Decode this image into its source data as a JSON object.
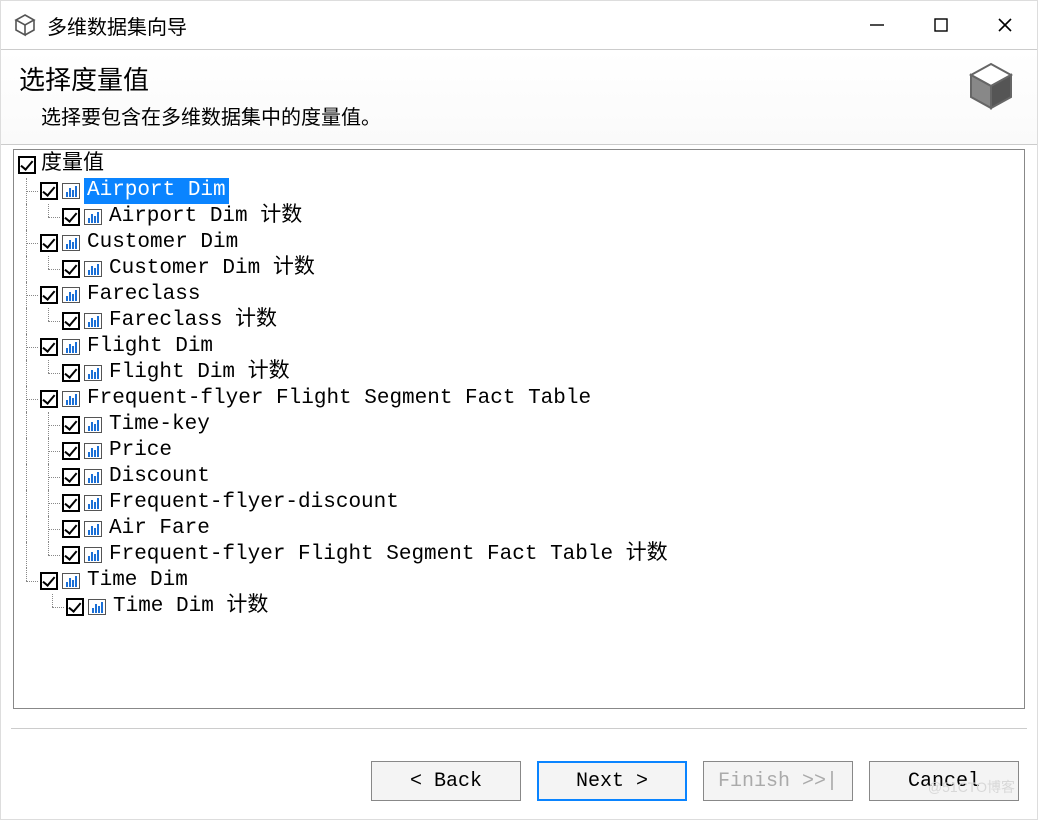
{
  "window": {
    "title": "多维数据集向导"
  },
  "header": {
    "title": "选择度量值",
    "subtitle": "选择要包含在多维数据集中的度量值。"
  },
  "tree": {
    "root": {
      "label": "度量值",
      "checked": true
    },
    "groups": [
      {
        "label": "Airport Dim",
        "checked": true,
        "selected": true,
        "children": [
          {
            "label": "Airport Dim 计数",
            "checked": true
          }
        ]
      },
      {
        "label": "Customer Dim",
        "checked": true,
        "children": [
          {
            "label": "Customer Dim 计数",
            "checked": true
          }
        ]
      },
      {
        "label": "Fareclass",
        "checked": true,
        "children": [
          {
            "label": "Fareclass 计数",
            "checked": true
          }
        ]
      },
      {
        "label": "Flight Dim",
        "checked": true,
        "children": [
          {
            "label": "Flight Dim 计数",
            "checked": true
          }
        ]
      },
      {
        "label": "Frequent-flyer Flight Segment Fact Table",
        "checked": true,
        "children": [
          {
            "label": "Time-key",
            "checked": true
          },
          {
            "label": "Price",
            "checked": true
          },
          {
            "label": "Discount",
            "checked": true
          },
          {
            "label": "Frequent-flyer-discount",
            "checked": true
          },
          {
            "label": "Air Fare",
            "checked": true
          },
          {
            "label": "Frequent-flyer Flight Segment Fact Table 计数",
            "checked": true
          }
        ]
      },
      {
        "label": "Time Dim",
        "checked": true,
        "children": [
          {
            "label": "Time Dim 计数",
            "checked": true
          }
        ]
      }
    ]
  },
  "buttons": {
    "back": "< Back",
    "next": "Next >",
    "finish": "Finish >>|",
    "cancel": "Cancel",
    "finish_disabled": true
  },
  "watermark": "@51CTO博客"
}
